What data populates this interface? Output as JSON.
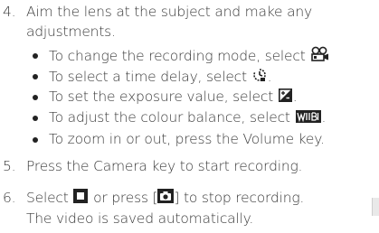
{
  "steps": [
    {
      "number": "4.",
      "text_line1": "Aim the lens at the subject and make any",
      "text_line2": "adjustments."
    },
    {
      "number": "5.",
      "text": "Press the Camera key to start recording."
    },
    {
      "number": "6.",
      "text_a": "Select",
      "text_b": "or press [",
      "text_c": "] to stop recording.",
      "text_line2": "The video is saved automatically."
    }
  ],
  "bullets": [
    {
      "before": "To change the recording mode, select",
      "after": ""
    },
    {
      "before": "To select a time delay, select",
      "after": "."
    },
    {
      "before": "To set the exposure value, select",
      "after": "."
    },
    {
      "before": "To adjust the colour balance, select",
      "after": "."
    },
    {
      "before": "To zoom in or out, press the Volume key.",
      "after": ""
    }
  ],
  "icons": {
    "recording_mode": "recording-mode-icon",
    "timer": "timer-icon",
    "exposure": "exposure-icon",
    "white_balance": "white-balance-icon",
    "stop": "stop-icon",
    "camera_key": "camera-key-icon"
  },
  "colors": {
    "text": "#3a3a3a",
    "icon": "#222222"
  }
}
